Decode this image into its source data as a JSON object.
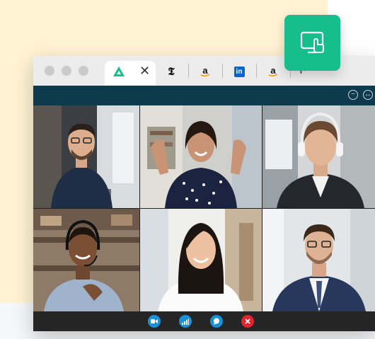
{
  "colors": {
    "accent_green": "#15be8a",
    "app_bar": "#0d3b4d",
    "toolbar": "#252525",
    "button_blue": "#1a90d8",
    "button_red": "#e2252c",
    "background": "#fff3d3"
  },
  "browser": {
    "tabs": [
      {
        "icon": "brand-triangle-icon",
        "active": true,
        "closable": true
      },
      {
        "icon": "nyt-logo-icon",
        "letter": "𝕿"
      },
      {
        "icon": "amazon-logo-icon",
        "letter": "a"
      },
      {
        "icon": "linkedin-logo-icon",
        "letter": "in"
      },
      {
        "icon": "amazon-logo-icon",
        "letter": "a"
      }
    ],
    "new_tab_symbol": "+",
    "close_symbol": "✕"
  },
  "app": {
    "window_controls": [
      "minimize-icon",
      "expand-icon"
    ],
    "participants": [
      {
        "position": "top-left",
        "description": "man with glasses at laptop"
      },
      {
        "position": "top-center",
        "description": "woman waving"
      },
      {
        "position": "top-right",
        "description": "man with headphones"
      },
      {
        "position": "bottom-left",
        "description": "man with headset"
      },
      {
        "position": "bottom-center",
        "description": "smiling woman"
      },
      {
        "position": "bottom-right",
        "description": "man with glasses in suit"
      }
    ],
    "controls": [
      {
        "icon": "video-camera-icon",
        "color": "#1a90d8"
      },
      {
        "icon": "signal-bars-icon",
        "color": "#1a90d8"
      },
      {
        "icon": "chat-bubble-icon",
        "color": "#1a90d8"
      },
      {
        "icon": "end-call-icon",
        "color": "#e2252c"
      }
    ]
  },
  "floating_action": {
    "icon": "screen-share-icon"
  }
}
